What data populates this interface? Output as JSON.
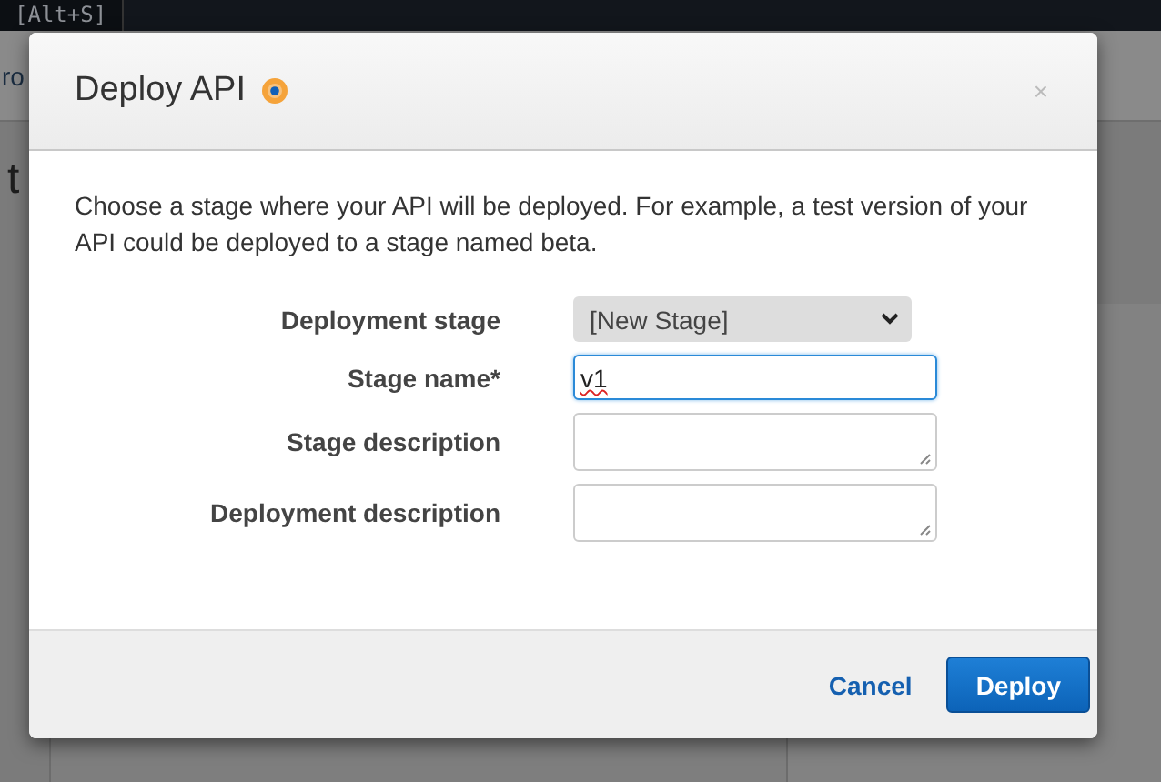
{
  "background": {
    "shortcut": "[Alt+S]",
    "breadcrumb": "ro",
    "heading": "t"
  },
  "dialog": {
    "title": "Deploy API",
    "close": "×",
    "description": "Choose a stage where your API will be deployed. For example, a test version of your API could be deployed to a stage named beta.",
    "fields": [
      {
        "kind": "select",
        "label": "Deployment stage",
        "value": "[New Stage]",
        "focused": false
      },
      {
        "kind": "text",
        "label": "Stage name*",
        "value": "v1",
        "focused": true
      },
      {
        "kind": "textarea",
        "label": "Stage description",
        "focused": false
      },
      {
        "kind": "textarea",
        "label": "Deployment description",
        "focused": false
      }
    ],
    "buttons": [
      {
        "kind": "link",
        "label": "Cancel"
      },
      {
        "kind": "primary",
        "label": "Deploy"
      }
    ]
  }
}
